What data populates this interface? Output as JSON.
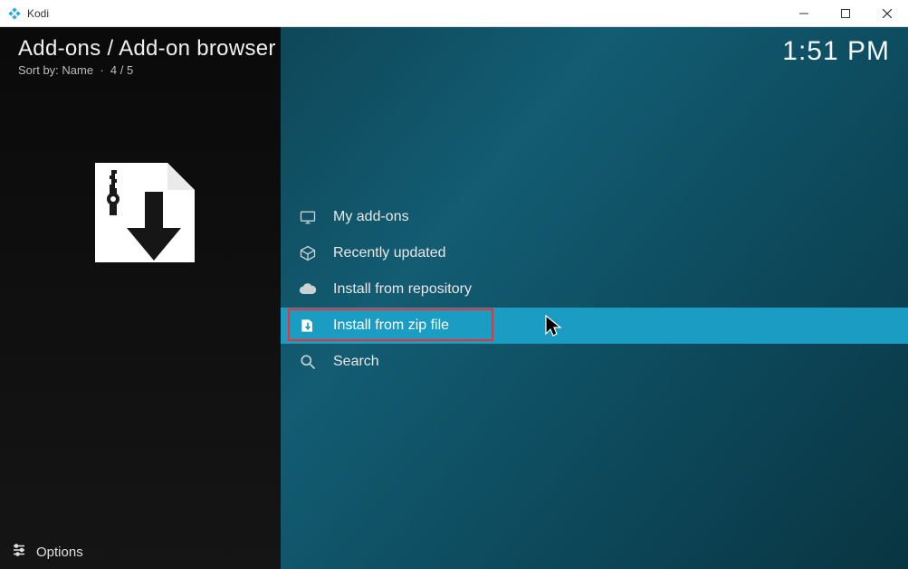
{
  "window": {
    "title": "Kodi"
  },
  "header": {
    "breadcrumb": "Add-ons / Add-on browser",
    "sort_label": "Sort by: Name",
    "position": "4 / 5",
    "clock": "1:51 PM"
  },
  "menu": {
    "items": [
      {
        "icon": "monitor-icon",
        "label": "My add-ons",
        "selected": false
      },
      {
        "icon": "box-icon",
        "label": "Recently updated",
        "selected": false
      },
      {
        "icon": "cloud-icon",
        "label": "Install from repository",
        "selected": false
      },
      {
        "icon": "zip-install-icon",
        "label": "Install from zip file",
        "selected": true
      },
      {
        "icon": "search-icon",
        "label": "Search",
        "selected": false
      }
    ]
  },
  "footer": {
    "options_label": "Options"
  }
}
